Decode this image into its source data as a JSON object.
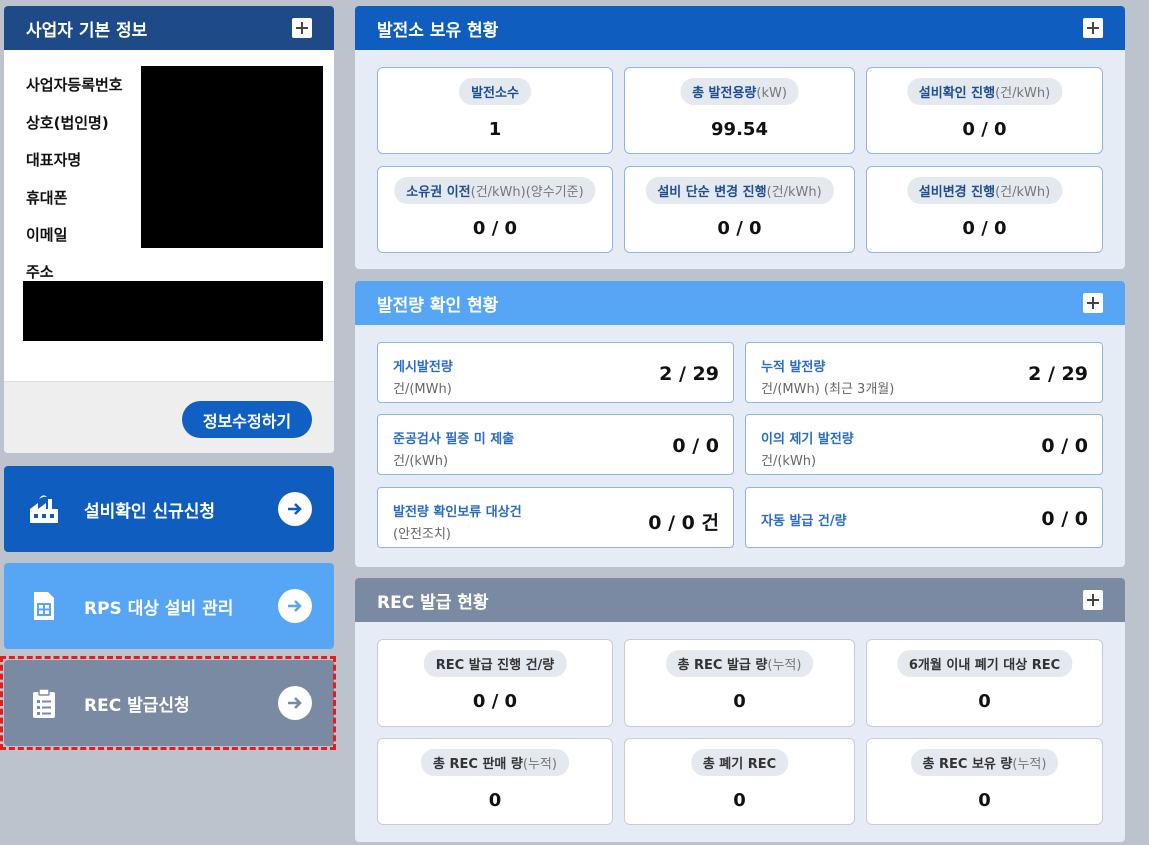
{
  "profile": {
    "title": "사업자 기본 정보",
    "labels": [
      "사업자등록번호",
      "상호(법인명)",
      "대표자명",
      "휴대폰",
      "이메일",
      "주소"
    ],
    "edit_button": "정보수정하기"
  },
  "nav": {
    "cert": "설비확인 신규신청",
    "rps": "RPS 대상 설비 관리",
    "rec": "REC 발급신청"
  },
  "own": {
    "title": "발전소 보유 현황",
    "cards": [
      {
        "label": "발전소수",
        "sub": "",
        "value": "1"
      },
      {
        "label": "총 발전용량",
        "sub": "(kW)",
        "value": "99.54"
      },
      {
        "label": "설비확인 진행",
        "sub": "(건/kWh)",
        "value": "0 / 0"
      },
      {
        "label": "소유권 이전",
        "sub": "(건/kWh)(양수기준)",
        "value": "0 / 0"
      },
      {
        "label": "설비 단순 변경 진행",
        "sub": "(건/kWh)",
        "value": "0 / 0"
      },
      {
        "label": "설비변경 진행",
        "sub": "(건/kWh)",
        "value": "0 / 0"
      }
    ]
  },
  "gen": {
    "title": "발전량 확인 현황",
    "cards": [
      {
        "title": "게시발전량",
        "sub": "건/(MWh)",
        "value": "2 / 29"
      },
      {
        "title": "누적 발전량",
        "sub": "건/(MWh) (최근 3개월)",
        "value": "2 / 29"
      },
      {
        "title": "준공검사 필증 미 제출",
        "sub": "건/(kWh)",
        "value": "0 / 0"
      },
      {
        "title": "이의 제기 발전량",
        "sub": "건/(kWh)",
        "value": "0 / 0"
      },
      {
        "title": "발전량 확인보류 대상건",
        "sub": "(안전조치)",
        "value": "0 / 0 건"
      },
      {
        "title": "자동 발급 건/량",
        "sub": "",
        "value": "0 / 0"
      }
    ]
  },
  "rec": {
    "title": "REC 발급 현황",
    "cards": [
      {
        "label": "REC 발급 진행 건/량",
        "sub": "",
        "value": "0 / 0"
      },
      {
        "label": "총 REC 발급 량",
        "sub": "(누적)",
        "value": "0"
      },
      {
        "label": "6개월 이내 폐기 대상 REC",
        "sub": "",
        "value": "0"
      },
      {
        "label": "총 REC 판매 량",
        "sub": "(누적)",
        "value": "0"
      },
      {
        "label": "총 폐기 REC",
        "sub": "",
        "value": "0"
      },
      {
        "label": "총 REC 보유 량",
        "sub": "(누적)",
        "value": "0"
      }
    ]
  },
  "icons": {
    "plus": "plus-icon",
    "factory": "factory-icon",
    "document": "document-icon",
    "clipboard": "clipboard-icon",
    "arrow": "arrow-right-icon"
  }
}
